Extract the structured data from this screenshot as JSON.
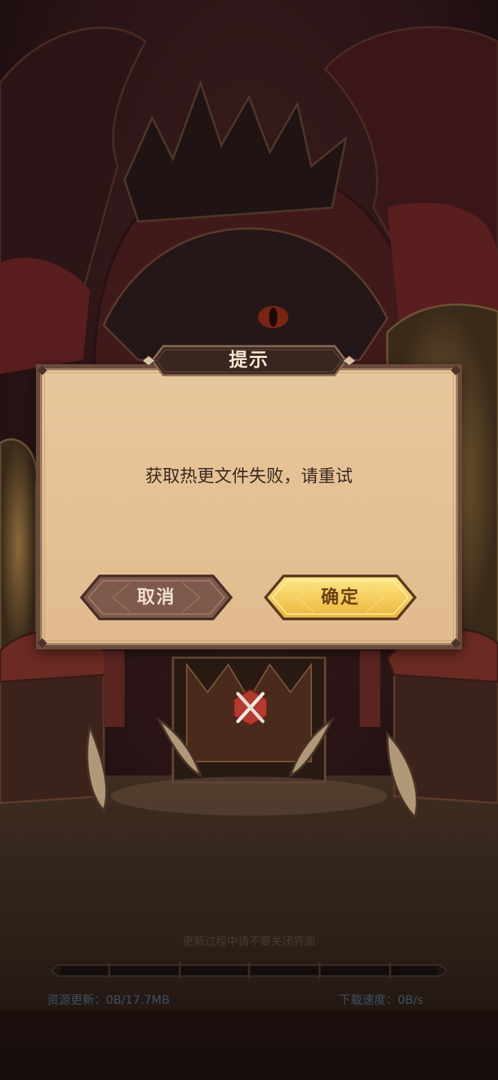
{
  "dialog": {
    "title": "提示",
    "message": "获取热更文件失败，请重试",
    "cancel_label": "取消",
    "confirm_label": "确定"
  },
  "update": {
    "hint": "更新过程中请不要关闭界面",
    "progress_fraction": 0,
    "resource_prefix": "资源更新：",
    "resource_value": "0B/17.7MB",
    "speed_prefix": "下载速度：",
    "speed_value": "0B/s"
  },
  "icons": {
    "center_emblem": "crossed-swords-icon"
  },
  "colors": {
    "dialog_bg": "#e8c79c",
    "dialog_border": "#6b4a3c",
    "confirm_gold": "#f3cf55",
    "cancel_brown": "#7e5a4d",
    "title_plate": "#3a2620"
  }
}
